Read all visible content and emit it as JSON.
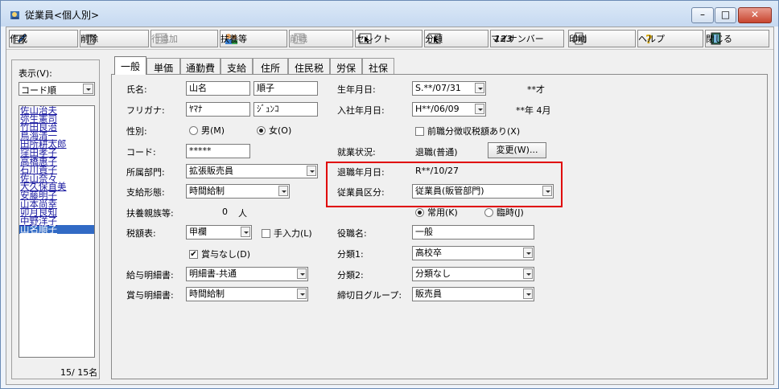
{
  "window": {
    "title": "従業員<個人別>"
  },
  "toolbar": {
    "buttons": [
      {
        "label": "作成",
        "icon": "edit-icon"
      },
      {
        "label": "削除",
        "icon": "trash-icon"
      },
      {
        "label": "行追加",
        "icon": "add-row-icon",
        "disabled": true
      },
      {
        "label": "扶養等",
        "icon": "people-icon"
      },
      {
        "label": "前職",
        "icon": "history-icon",
        "disabled": true
      },
      {
        "label": "セレクト",
        "icon": "select-icon"
      },
      {
        "label": "分類",
        "icon": "category-icon"
      },
      {
        "label": "マイナンバー",
        "icon": "mynumber-icon",
        "prefix": "123"
      },
      {
        "label": "印刷",
        "icon": "printer-icon"
      },
      {
        "label": "ヘルプ",
        "icon": "help-icon"
      },
      {
        "label": "閉じる",
        "icon": "exit-icon"
      }
    ]
  },
  "left": {
    "display_label": "表示(V):",
    "sort_value": "コード順",
    "employees": [
      "佐山治夫",
      "弥生憲司",
      "竹田良治",
      "鳥海清一",
      "田所耕太郎",
      "窪田孝子",
      "高橋惠子",
      "石川貴子",
      "佐山奈々",
      "大久保直美",
      "安藤明子",
      "山本尚幸",
      "卯月良知",
      "中野洋子",
      "山名順子"
    ],
    "selected_index": 14,
    "count": "15/  15名"
  },
  "tabs": [
    "一般",
    "単価",
    "通勤費",
    "支給",
    "住所",
    "住民税",
    "労保",
    "社保"
  ],
  "form": {
    "name_label": "氏名:",
    "last_name": "山名",
    "first_name": "順子",
    "kana_label": "フリガナ:",
    "last_kana": "ﾔﾏﾅ",
    "first_kana": "ｼﾞｭﾝｺ",
    "gender_label": "性別:",
    "male": "男(M)",
    "female": "女(O)",
    "code_label": "コード:",
    "code": "*****",
    "dept_label": "所属部門:",
    "dept": "拡張販売員",
    "pay_type_label": "支給形態:",
    "pay_type": "時間給制",
    "dependents_label": "扶養親族等:",
    "dependents_count": "0",
    "dependents_unit": "人",
    "tax_table_label": "税額表:",
    "tax_table": "甲欄",
    "manual_input": "手入力(L)",
    "no_bonus": "賞与なし(D)",
    "pay_slip_label": "給与明細書:",
    "pay_slip": "明細書-共通",
    "bonus_slip_label": "賞与明細書:",
    "bonus_slip": "時間給制",
    "birth_label": "生年月日:",
    "birth": "S.**/07/31",
    "age": "**才",
    "join_label": "入社年月日:",
    "join": "H**/06/09",
    "tenure": "**年 4月",
    "prev_job_tax": "前職分徴収税額あり(X)",
    "status_label": "就業状況:",
    "status": "退職(普通)",
    "change_button": "変更(W)...",
    "retire_label": "退職年月日:",
    "retire": "R**/10/27",
    "emp_class_label": "従業員区分:",
    "emp_class": "従業員(販管部門)",
    "regular": "常用(K)",
    "temporary": "臨時(J)",
    "position_label": "役職名:",
    "position": "一般",
    "class1_label": "分類1:",
    "class1": "高校卒",
    "class2_label": "分類2:",
    "class2": "分類なし",
    "cutoff_label": "締切日グループ:",
    "cutoff": "販売員"
  }
}
